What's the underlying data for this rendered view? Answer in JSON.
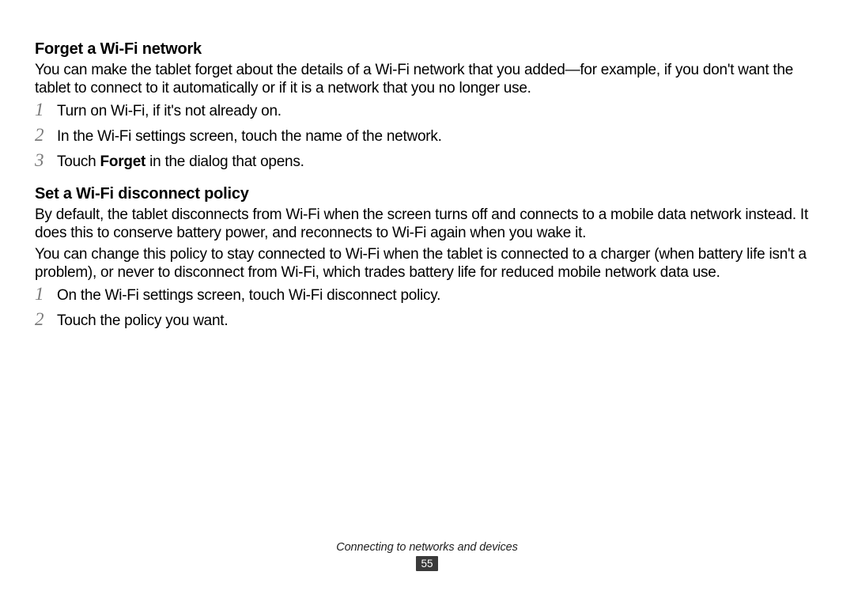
{
  "section1": {
    "heading": "Forget a Wi-Fi network",
    "intro": "You can make the tablet forget about the details of a Wi-Fi network that you added—for example, if you don't want the tablet to connect to it automatically or if it is a network that you no longer use.",
    "steps": [
      {
        "n": "1",
        "text": "Turn on Wi-Fi, if it's not already on."
      },
      {
        "n": "2",
        "text": "In the Wi-Fi settings screen, touch the name of the network."
      },
      {
        "n": "3",
        "pre": "Touch ",
        "bold": "Forget",
        "post": " in the dialog that opens."
      }
    ]
  },
  "section2": {
    "heading": "Set a Wi-Fi disconnect policy",
    "para1": "By default, the tablet disconnects from Wi-Fi when the screen turns off and connects to a mobile data network instead. It does this to conserve battery power, and reconnects to Wi-Fi again when you wake it.",
    "para2": "You can change this policy to stay connected to Wi-Fi when the tablet is connected to a charger (when battery life isn't a problem), or never to disconnect from Wi-Fi, which trades battery life for reduced mobile network data use.",
    "steps": [
      {
        "n": "1",
        "text": "On the Wi-Fi settings screen, touch Wi-Fi disconnect policy."
      },
      {
        "n": "2",
        "text": "Touch the policy you want."
      }
    ]
  },
  "footer": {
    "chapter": "Connecting to networks and devices",
    "page": "55"
  }
}
